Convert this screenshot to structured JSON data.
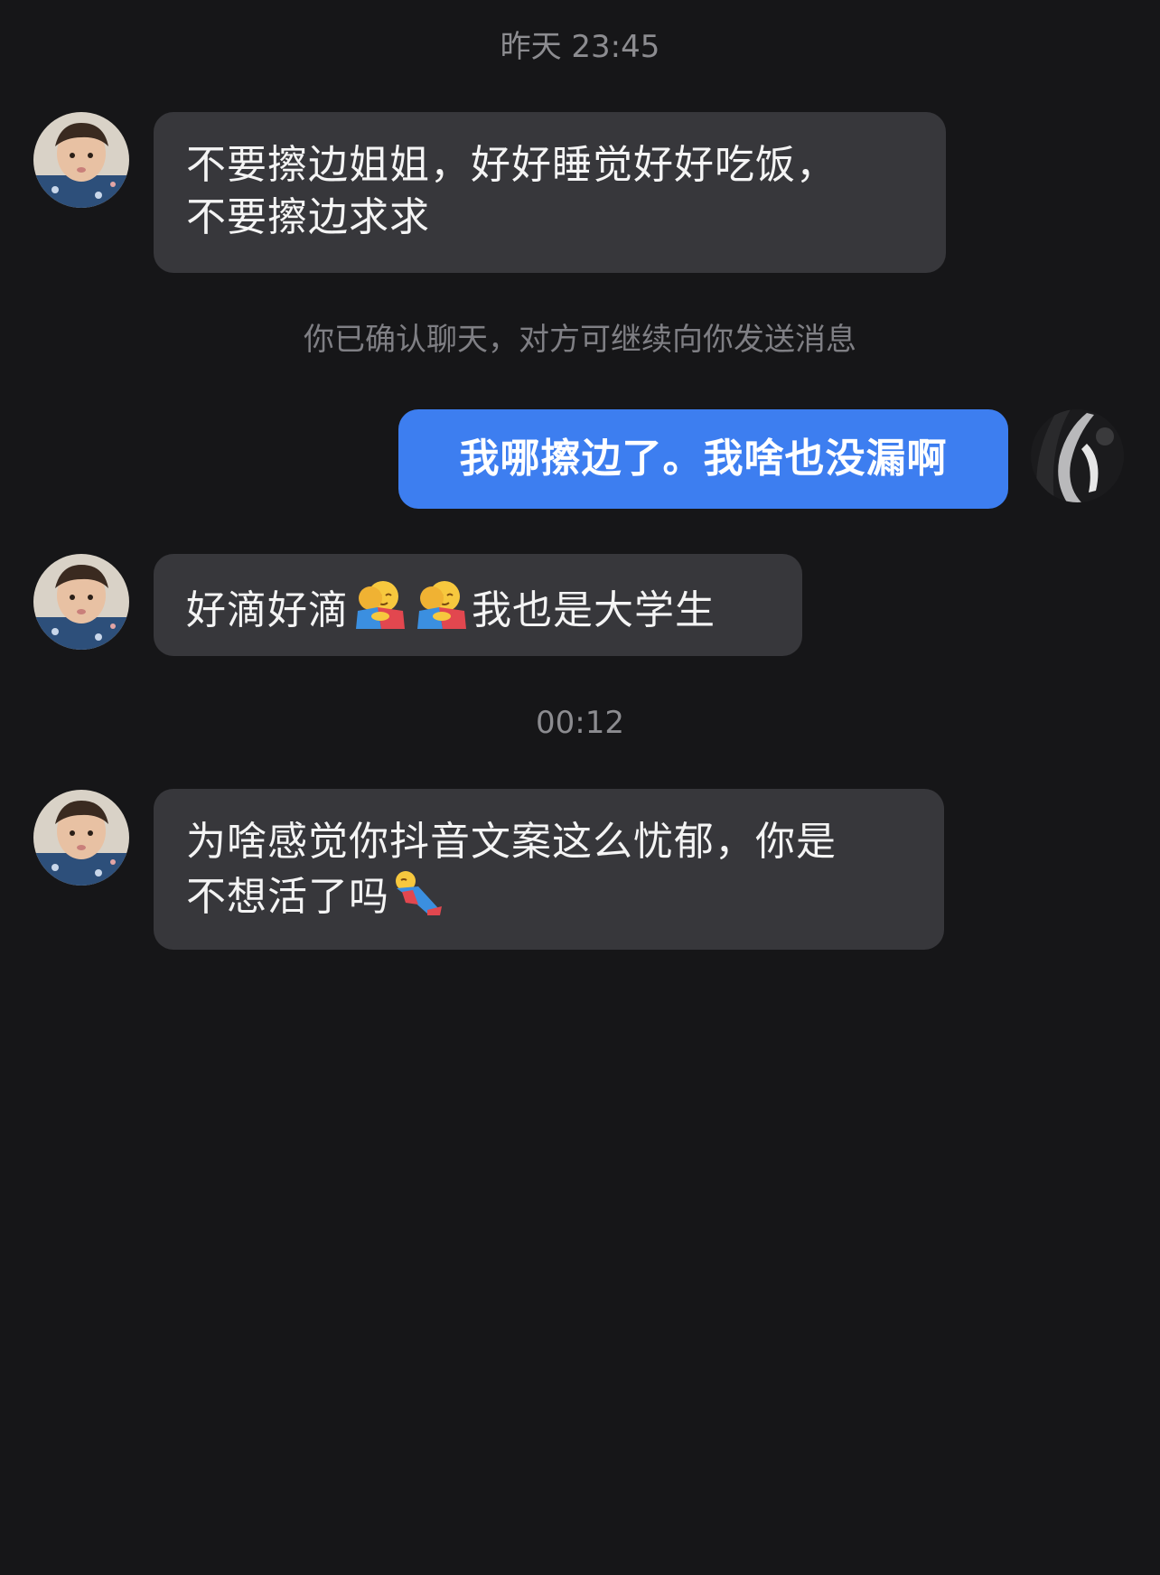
{
  "chat": {
    "time_1": "昨天 23:45",
    "message_1": {
      "line_1": "不要擦边姐姐，好好睡觉好好吃饭，",
      "line_2": "不要擦边求求"
    },
    "system_note": "你已确认聊天，对方可继续向你发送消息",
    "message_2": {
      "text": "我哪擦边了。我啥也没漏啊"
    },
    "message_3": {
      "text_before": "好滴好滴",
      "emoji_1": "hug-emoji",
      "emoji_2": "hug-emoji",
      "text_after": "我也是大学生"
    },
    "time_2": "00:12",
    "message_4": {
      "line_1": "为啥感觉你抖音文案这么忧郁，你是",
      "line_2_text": "不想活了吗",
      "emoji": "lying-person-emoji"
    }
  },
  "colors": {
    "background": "#161618",
    "incoming_bubble": "#37373b",
    "outgoing_bubble": "#3d7ef0",
    "meta_text": "#8c8c90"
  }
}
